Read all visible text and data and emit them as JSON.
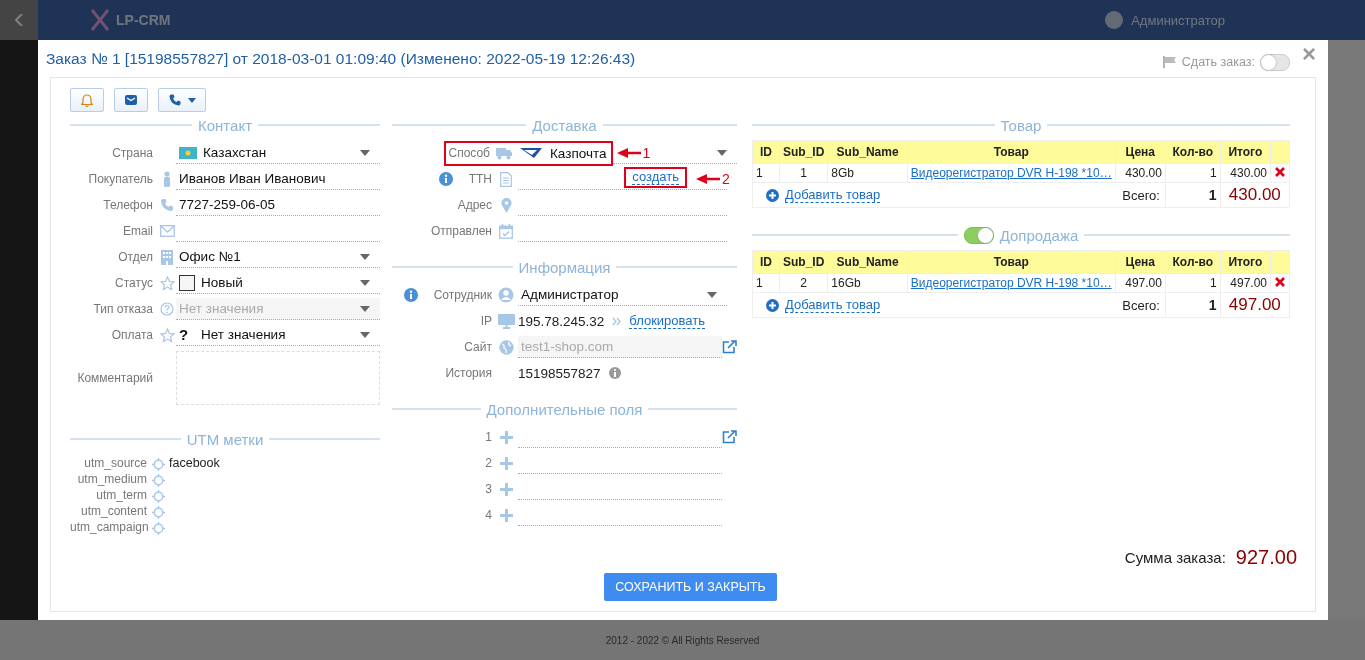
{
  "app": {
    "logo": "LP-CRM",
    "user": "Администратор",
    "footer": "2012 - 2022 © All Rights Reserved"
  },
  "modal": {
    "title": "Заказ № 1 [15198557827] от 2018-03-01 01:09:40 (Изменено: 2022-05-19 12:26:43)",
    "close": "×",
    "submit_toggle": {
      "label": "Сдать заказ:",
      "on": false
    }
  },
  "contact": {
    "title": "Контакт",
    "fields": [
      {
        "label": "Страна",
        "kind": "select",
        "value": "Казахстан"
      },
      {
        "label": "Покупатель",
        "kind": "input",
        "value": "Иванов Иван Иванович"
      },
      {
        "label": "Телефон",
        "kind": "input",
        "value": "7727-259-06-05"
      },
      {
        "label": "Email",
        "kind": "input"
      },
      {
        "label": "Отдел",
        "kind": "select",
        "value": "Офис №1"
      },
      {
        "label": "Статус",
        "kind": "select",
        "value": "Новый",
        "color": "#f5f5f5"
      },
      {
        "label": "Тип отказа",
        "kind": "select",
        "value": "Нет значения",
        "disabled": true
      },
      {
        "label": "Оплата",
        "kind": "select",
        "prefix": "?",
        "value": "Нет значения"
      },
      {
        "label": "Комментарий",
        "kind": "textarea"
      }
    ]
  },
  "utm": {
    "title": "UTM метки",
    "rows": [
      {
        "label": "utm_source",
        "value": "facebook"
      },
      {
        "label": "utm_medium"
      },
      {
        "label": "utm_term"
      },
      {
        "label": "utm_content"
      },
      {
        "label": "utm_campaign"
      }
    ]
  },
  "delivery": {
    "title": "Доставка",
    "fields": [
      {
        "label": "Способ",
        "kind": "select",
        "value": "Казпочта",
        "annotation": "1"
      },
      {
        "label": "ТТН",
        "kind": "input",
        "info": true,
        "link": "создать",
        "annotation": "2"
      },
      {
        "label": "Адрес",
        "kind": "input"
      },
      {
        "label": "Отправлен",
        "kind": "input"
      }
    ]
  },
  "information": {
    "title": "Информация",
    "fields": [
      {
        "label": "Сотрудник",
        "kind": "select",
        "info": true,
        "value": "Администратор"
      },
      {
        "label": "IP",
        "kind": "ip",
        "value": "195.78.245.32",
        "link": "блокировать"
      },
      {
        "label": "Сайт",
        "kind": "site",
        "value": "test1-shop.com"
      },
      {
        "label": "История",
        "kind": "history",
        "value": "15198557827"
      }
    ]
  },
  "extra_fields": {
    "title": "Дополнительные поля",
    "fields": [
      {
        "label": "1",
        "external": true
      },
      {
        "label": "2",
        "external": false
      },
      {
        "label": "3",
        "external": false
      },
      {
        "label": "4",
        "external": false
      }
    ]
  },
  "products": {
    "title": "Товар",
    "columns": [
      "ID",
      "Sub_ID",
      "Sub_Name",
      "Товар",
      "Цена",
      "Кол-во",
      "Итого"
    ],
    "rows": [
      {
        "cells": [
          "1",
          "1",
          "8Gb",
          "Видеорегистратор DVR H-198 *10…",
          "430.00",
          "1",
          "430.00"
        ]
      }
    ],
    "add": "Добавить товар",
    "total_label": "Всего:",
    "total_qty": "1",
    "total_sum": "430.00"
  },
  "upsell": {
    "title": "Допродажа",
    "on": true,
    "columns": [
      "ID",
      "Sub_ID",
      "Sub_Name",
      "Товар",
      "Цена",
      "Кол-во",
      "Итого"
    ],
    "rows": [
      {
        "cells": [
          "1",
          "2",
          "16Gb",
          "Видеорегистратор DVR H-198 *10…",
          "497.00",
          "1",
          "497.00"
        ]
      }
    ],
    "add": "Добавить товар",
    "total_label": "Всего:",
    "total_qty": "1",
    "total_sum": "497.00"
  },
  "order_total": {
    "label": "Сумма заказа:",
    "value": "927.00"
  },
  "save_button": "СОХРАНИТЬ И ЗАКРЫТЬ"
}
